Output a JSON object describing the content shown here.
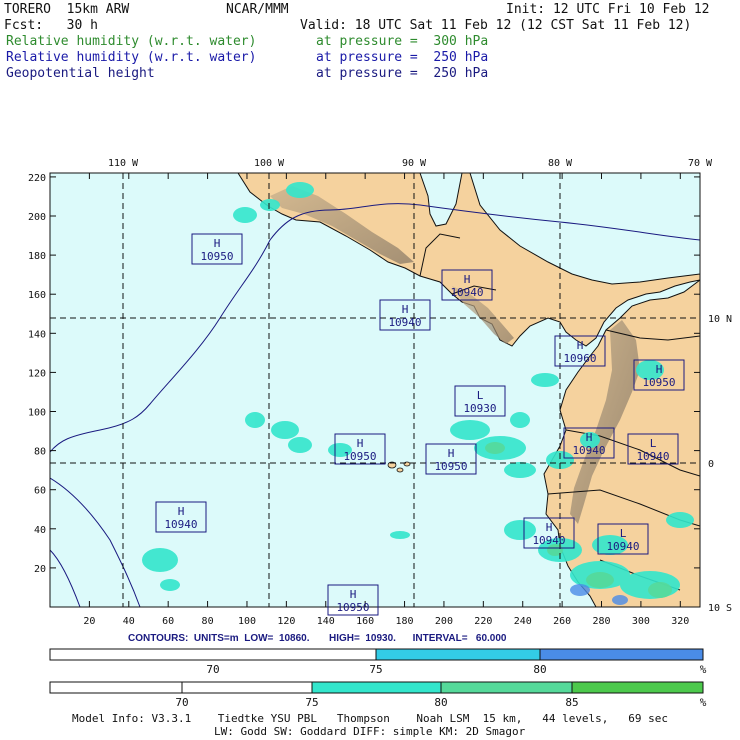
{
  "header": {
    "model": "TORERO  15km ARW",
    "org": "NCAR/MMM",
    "init": "Init: 12 UTC Fri 10 Feb 12",
    "fcst": "Fcst:   30 h",
    "valid": "Valid: 18 UTC Sat 11 Feb 12 (12 CST Sat 11 Feb 12)",
    "fields": [
      {
        "name": "Relative humidity (w.r.t. water)",
        "level": "at pressure =  300 hPa",
        "color": "#2e8b2e"
      },
      {
        "name": "Relative humidity (w.r.t. water)",
        "level": "at pressure =  250 hPa",
        "color": "#1a1aa8"
      },
      {
        "name": "Geopotential height",
        "level": "at pressure =  250 hPa",
        "color": "#1a1a80"
      }
    ]
  },
  "map": {
    "lon_labels": [
      "110 W",
      "100 W",
      "90 W",
      "80 W",
      "70 W"
    ],
    "lat_labels": [
      "10 N",
      "0",
      "10 S"
    ],
    "x_ticks": [
      "20",
      "40",
      "60",
      "80",
      "100",
      "120",
      "140",
      "160",
      "180",
      "200",
      "220",
      "240",
      "260",
      "280",
      "300",
      "320"
    ],
    "y_ticks": [
      "20",
      "40",
      "60",
      "80",
      "100",
      "120",
      "140",
      "160",
      "180",
      "200",
      "220"
    ],
    "ocean_color": "#dcfafa",
    "land_color": "#f5d29e",
    "centers": [
      {
        "type": "H",
        "value": "10950"
      },
      {
        "type": "H",
        "value": "10940"
      },
      {
        "type": "H",
        "value": "10940"
      },
      {
        "type": "H",
        "value": "10960"
      },
      {
        "type": "H",
        "value": "10950"
      },
      {
        "type": "L",
        "value": "10930"
      },
      {
        "type": "H",
        "value": "10950"
      },
      {
        "type": "H",
        "value": "10950"
      },
      {
        "type": "H",
        "value": "10940"
      },
      {
        "type": "L",
        "value": "10940"
      },
      {
        "type": "H",
        "value": "10940"
      },
      {
        "type": "H",
        "value": "10940"
      },
      {
        "type": "L",
        "value": "10940"
      },
      {
        "type": "H",
        "value": "10950"
      }
    ]
  },
  "contours": {
    "text": "CONTOURS:  UNITS=m  LOW=  10860.       HIGH=  10930.      INTERVAL=   60.000"
  },
  "colorbar_250": {
    "labels": [
      "70",
      "75",
      "80",
      "%"
    ],
    "colors": [
      "#ffffff",
      "#33cce6",
      "#4a8ce8"
    ]
  },
  "colorbar_300": {
    "labels": [
      "70",
      "75",
      "80",
      "85",
      "%"
    ],
    "colors": [
      "#ffffff",
      "#ffffff",
      "#33e6cc",
      "#55d99a",
      "#4cc94c"
    ]
  },
  "footer": {
    "line1": "Model Info: V3.3.1    Tiedtke YSU PBL   Thompson    Noah LSM  15 km,   44 levels,   69 sec",
    "line2": "LW: Godd SW: Goddard DIFF: simple KM: 2D Smagor"
  }
}
